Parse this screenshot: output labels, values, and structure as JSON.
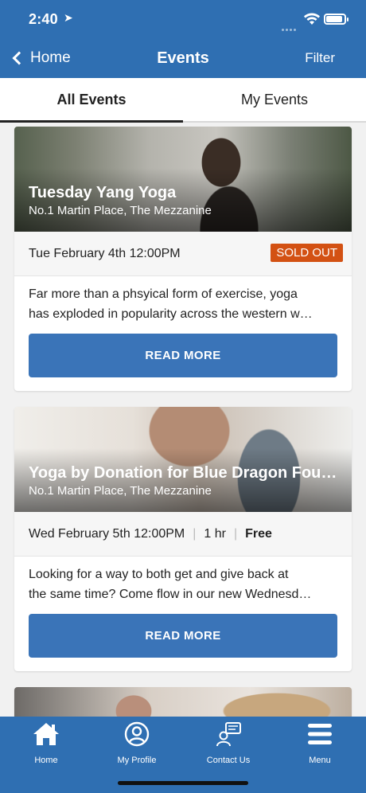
{
  "status_bar": {
    "time": "2:40"
  },
  "nav": {
    "back_label": "Home",
    "title": "Events",
    "filter_label": "Filter"
  },
  "tabs": [
    {
      "label": "All Events",
      "active": true
    },
    {
      "label": "My Events",
      "active": false
    }
  ],
  "events": [
    {
      "title": "Tuesday Yang Yoga",
      "location": "No.1 Martin Place, The Mezzanine",
      "datetime": "Tue February 4th 12:00PM",
      "badge": "SOLD OUT",
      "desc_line1": "Far more than a phsyical form of exercise, yoga",
      "desc_line2": "has exploded in popularity across the western w…",
      "button": "READ MORE"
    },
    {
      "title": "Yoga by Donation for Blue Dragon Foun…",
      "location": "No.1 Martin Place, The Mezzanine",
      "datetime": "Wed February 5th 12:00PM",
      "duration": "1 hr",
      "price": "Free",
      "desc_line1": "Looking for a way to both get and give back at",
      "desc_line2": "the same time? Come flow in our new Wednesd…",
      "button": "READ MORE"
    }
  ],
  "tabbar": [
    {
      "label": "Home",
      "icon": "home-icon"
    },
    {
      "label": "My Profile",
      "icon": "profile-icon"
    },
    {
      "label": "Contact Us",
      "icon": "contact-icon"
    },
    {
      "label": "Menu",
      "icon": "menu-icon"
    }
  ],
  "colors": {
    "primary": "#2f6fb2",
    "button": "#3a74b8",
    "sold_out": "#d35113"
  }
}
